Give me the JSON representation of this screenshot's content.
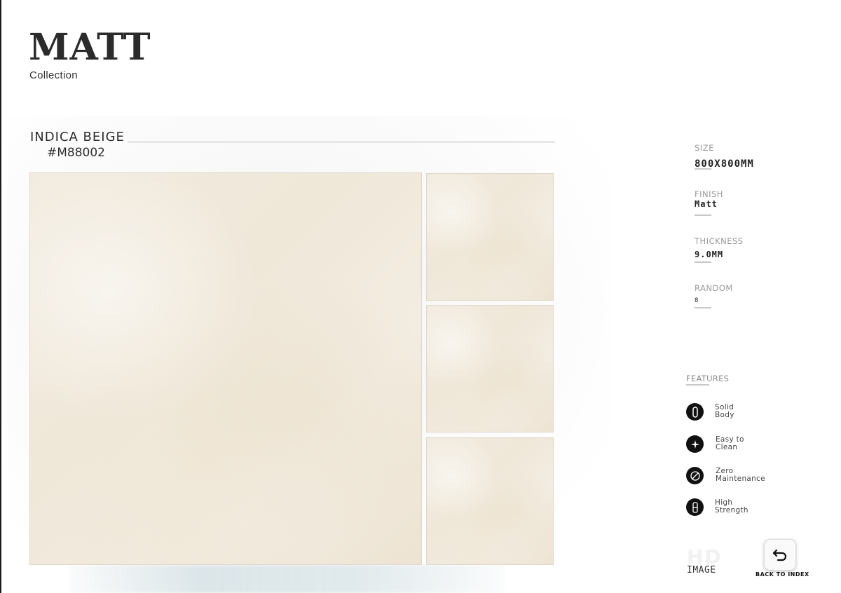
{
  "header": {
    "title": "MATT",
    "subtitle": "Collection"
  },
  "product": {
    "name": "INDICA BEIGE",
    "code": "#M88002"
  },
  "specs": {
    "size": {
      "label": "SIZE",
      "value": "800X800MM"
    },
    "finish": {
      "label": "FINISH",
      "value": "Matt"
    },
    "thickness": {
      "label": "THICKNESS",
      "value": "9.0MM"
    },
    "random": {
      "label": "RANDOM",
      "value": "8"
    }
  },
  "features": {
    "label": "FEATURES",
    "items": [
      {
        "text": "Solid\nBody",
        "icon": "solid-body-icon"
      },
      {
        "text": "Easy to\nClean",
        "icon": "sparkle-icon"
      },
      {
        "text": "Zero\nMaintenance",
        "icon": "no-maintenance-icon"
      },
      {
        "text": "High\nStrength",
        "icon": "strength-icon"
      }
    ]
  },
  "hd_image": {
    "ghost": "HD",
    "label": "IMAGE"
  },
  "navigation": {
    "back_label": "BACK TO INDEX",
    "back_icon": "return-arrow-icon"
  },
  "colors": {
    "tile": "#f0e8da",
    "text": "#2a2a2a",
    "muted": "#9a9a9a",
    "icon_bg": "#111111"
  }
}
